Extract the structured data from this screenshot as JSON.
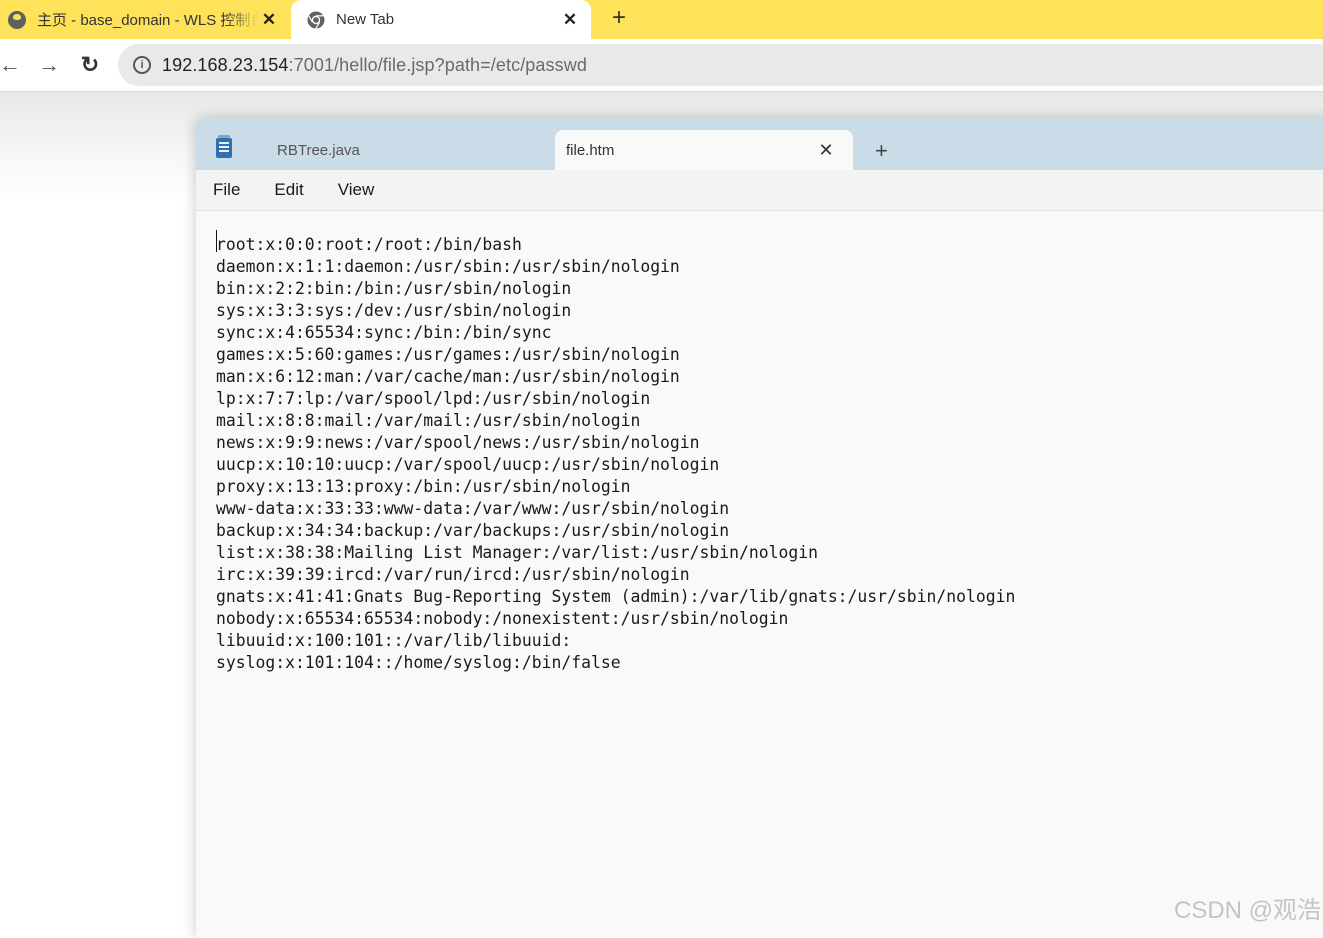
{
  "browser": {
    "tabs": [
      {
        "title": "主页 - base_domain - WLS 控制台",
        "close": "✕",
        "active": false
      },
      {
        "title": "New Tab",
        "close": "✕",
        "active": true
      }
    ],
    "new_tab": "+",
    "nav": {
      "back": "←",
      "forward": "→",
      "reload": "↻"
    },
    "address": {
      "host": "192.168.23.154",
      "rest": ":7001/hello/file.jsp?path=/etc/passwd"
    }
  },
  "notepad": {
    "tabs": [
      {
        "label": "RBTree.java",
        "active": false
      },
      {
        "label": "file.htm",
        "active": true,
        "close": "✕"
      }
    ],
    "add_tab": "+",
    "menu": [
      "File",
      "Edit",
      "View"
    ],
    "lines": [
      "root:x:0:0:root:/root:/bin/bash",
      "daemon:x:1:1:daemon:/usr/sbin:/usr/sbin/nologin",
      "bin:x:2:2:bin:/bin:/usr/sbin/nologin",
      "sys:x:3:3:sys:/dev:/usr/sbin/nologin",
      "sync:x:4:65534:sync:/bin:/bin/sync",
      "games:x:5:60:games:/usr/games:/usr/sbin/nologin",
      "man:x:6:12:man:/var/cache/man:/usr/sbin/nologin",
      "lp:x:7:7:lp:/var/spool/lpd:/usr/sbin/nologin",
      "mail:x:8:8:mail:/var/mail:/usr/sbin/nologin",
      "news:x:9:9:news:/var/spool/news:/usr/sbin/nologin",
      "uucp:x:10:10:uucp:/var/spool/uucp:/usr/sbin/nologin",
      "proxy:x:13:13:proxy:/bin:/usr/sbin/nologin",
      "www-data:x:33:33:www-data:/var/www:/usr/sbin/nologin",
      "backup:x:34:34:backup:/var/backups:/usr/sbin/nologin",
      "list:x:38:38:Mailing List Manager:/var/list:/usr/sbin/nologin",
      "irc:x:39:39:ircd:/var/run/ircd:/usr/sbin/nologin",
      "gnats:x:41:41:Gnats Bug-Reporting System (admin):/var/lib/gnats:/usr/sbin/nologin",
      "nobody:x:65534:65534:nobody:/nonexistent:/usr/sbin/nologin",
      "libuuid:x:100:101::/var/lib/libuuid:",
      "syslog:x:101:104::/home/syslog:/bin/false"
    ]
  },
  "watermark": "CSDN @观浩"
}
